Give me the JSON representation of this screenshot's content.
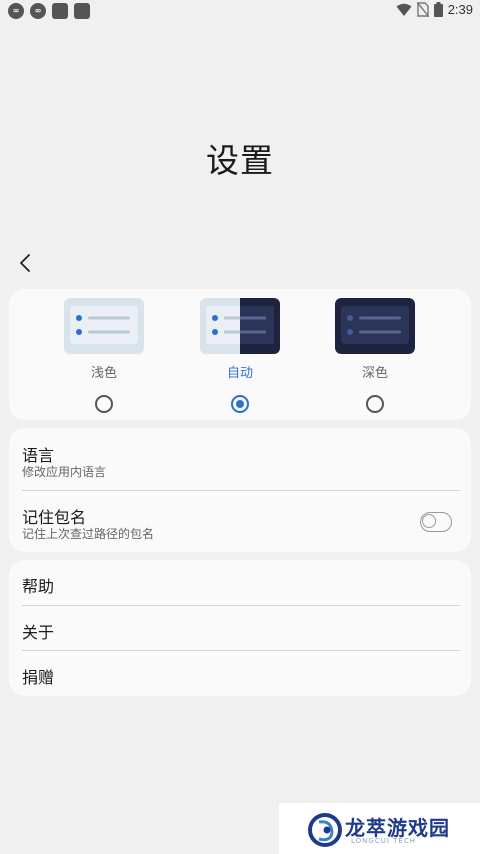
{
  "status_bar": {
    "time": "2:39",
    "left_icons": [
      "infinity-badge-icon",
      "infinity-badge-icon",
      "app-square-icon",
      "app-square-icon"
    ],
    "right_icons": [
      "wifi-icon",
      "no-sim-icon",
      "battery-icon"
    ]
  },
  "page": {
    "title": "设置"
  },
  "theme": {
    "options": [
      {
        "label": "浅色",
        "selected": false
      },
      {
        "label": "自动",
        "selected": true
      },
      {
        "label": "深色",
        "selected": false
      }
    ],
    "accent_color": "#2d6fd1"
  },
  "settings_group_1": {
    "language": {
      "title": "语言",
      "subtitle": "修改应用内语言"
    },
    "remember_package": {
      "title": "记住包名",
      "subtitle": "记住上次查过路径的包名",
      "enabled": false
    }
  },
  "settings_group_2": {
    "items": [
      {
        "title": "帮助"
      },
      {
        "title": "关于"
      },
      {
        "title": "捐赠"
      }
    ]
  },
  "watermark": {
    "text": "龙萃游戏园",
    "subtext": "LONGCUI TECH"
  }
}
